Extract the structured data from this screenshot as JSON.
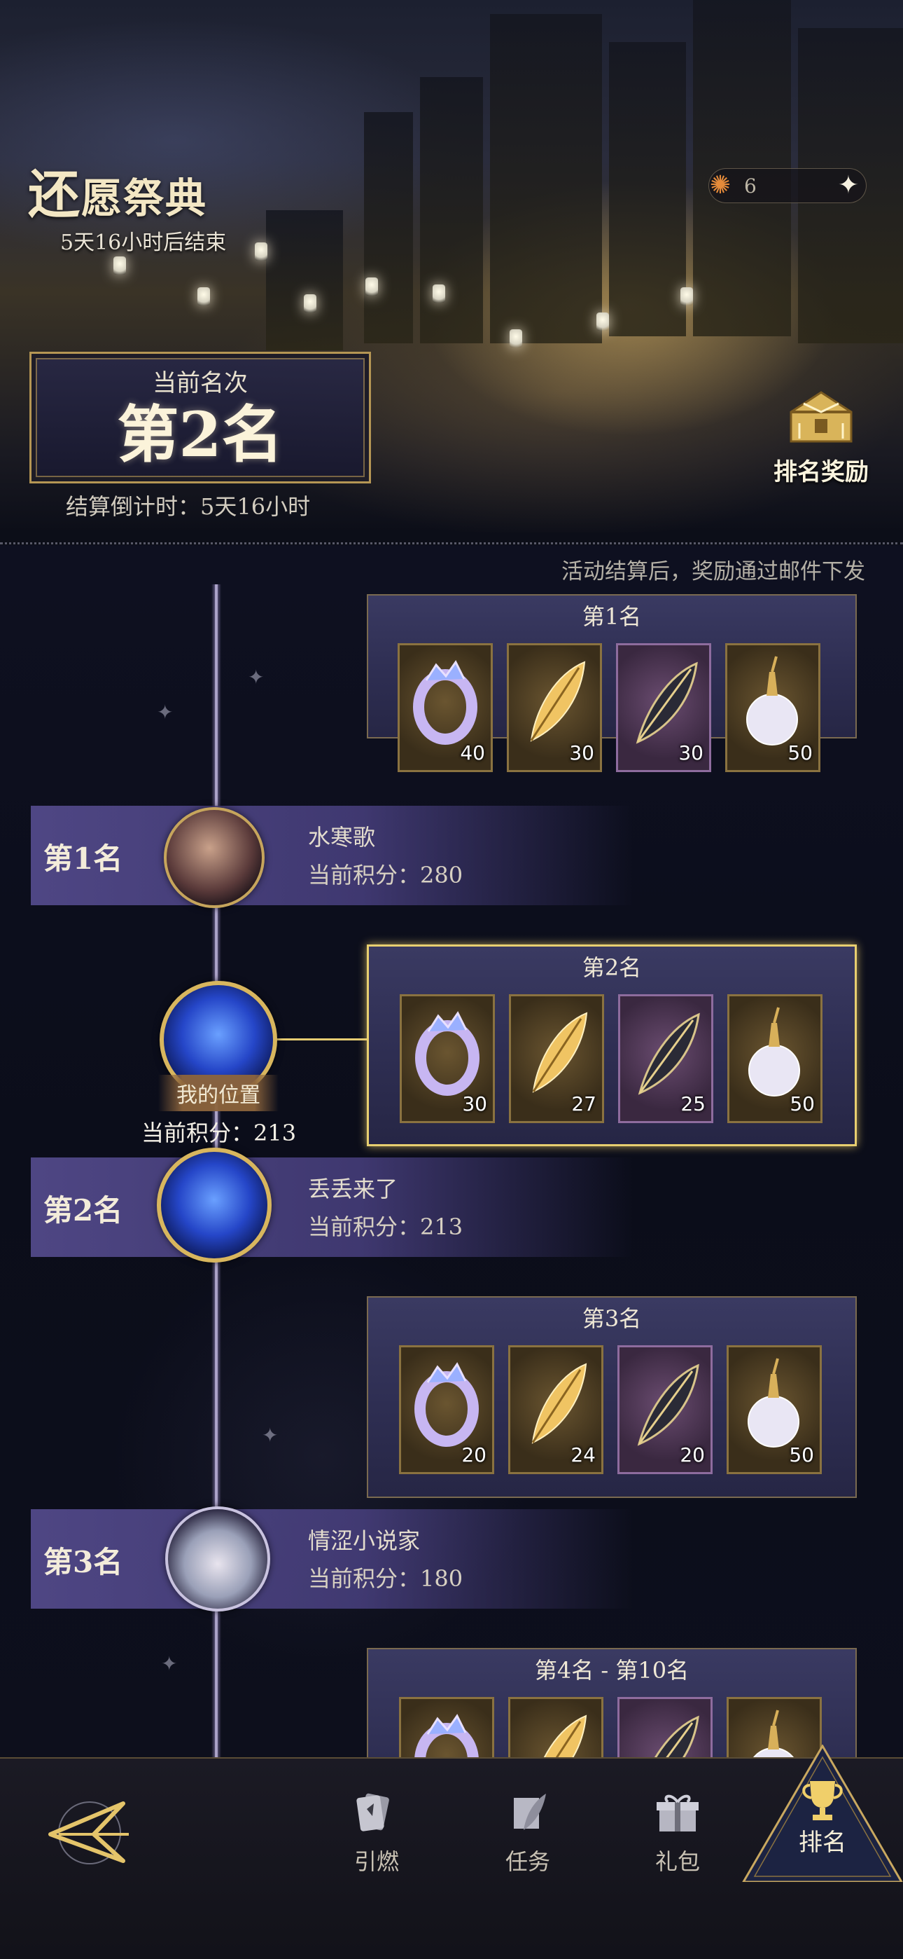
{
  "header": {
    "title_first_char": "还",
    "title_rest": "愿祭典",
    "remaining": "5天16小时后结束",
    "currency_value": "6",
    "currency_icon": "ember-coin-icon",
    "add_icon": "sparkle-plus-icon"
  },
  "rank_panel": {
    "label": "当前名次",
    "value": "第2名",
    "countdown": "结算倒计时：5天16小时"
  },
  "reward_button": {
    "label": "排名奖励",
    "icon": "treasure-chest-icon"
  },
  "notice": "活动结算后，奖励通过邮件下发",
  "reward_tiers": [
    {
      "title": "第1名",
      "items": [
        {
          "icon": "crystal-ring-icon",
          "qty": "40"
        },
        {
          "icon": "golden-feather-icon",
          "qty": "30"
        },
        {
          "icon": "dark-quill-icon",
          "qty": "30"
        },
        {
          "icon": "pearl-potion-icon",
          "qty": "50"
        }
      ]
    },
    {
      "title": "第2名",
      "items": [
        {
          "icon": "crystal-ring-icon",
          "qty": "30"
        },
        {
          "icon": "golden-feather-icon",
          "qty": "27"
        },
        {
          "icon": "dark-quill-icon",
          "qty": "25"
        },
        {
          "icon": "pearl-potion-icon",
          "qty": "50"
        }
      ]
    },
    {
      "title": "第3名",
      "items": [
        {
          "icon": "crystal-ring-icon",
          "qty": "20"
        },
        {
          "icon": "golden-feather-icon",
          "qty": "24"
        },
        {
          "icon": "dark-quill-icon",
          "qty": "20"
        },
        {
          "icon": "pearl-potion-icon",
          "qty": "50"
        }
      ]
    },
    {
      "title": "第4名 - 第10名",
      "items": [
        {
          "icon": "crystal-ring-icon",
          "qty": ""
        },
        {
          "icon": "golden-feather-icon",
          "qty": ""
        },
        {
          "icon": "dark-quill-icon",
          "qty": ""
        },
        {
          "icon": "pearl-potion-icon",
          "qty": ""
        }
      ]
    }
  ],
  "players": [
    {
      "rank": "第1名",
      "name": "水寒歌",
      "score": "当前积分：280"
    },
    {
      "rank": "第2名",
      "name": "丢丢来了",
      "score": "当前积分：213"
    },
    {
      "rank": "第3名",
      "name": "情涩小说家",
      "score": "当前积分：180"
    }
  ],
  "my_position": {
    "tag": "我的位置",
    "score": "当前积分：213"
  },
  "nav": {
    "items": [
      {
        "label": "引燃",
        "icon": "cards-icon"
      },
      {
        "label": "任务",
        "icon": "scroll-feather-icon"
      },
      {
        "label": "礼包",
        "icon": "gift-icon"
      },
      {
        "label": "排名",
        "icon": "trophy-icon"
      }
    ],
    "back_icon": "back-arrow-emblem-icon"
  },
  "colors": {
    "accent_gold": "#e8cf70",
    "panel_purple": "#3a3a62",
    "row_purple": "#5a5096",
    "background": "#0c0e18"
  }
}
